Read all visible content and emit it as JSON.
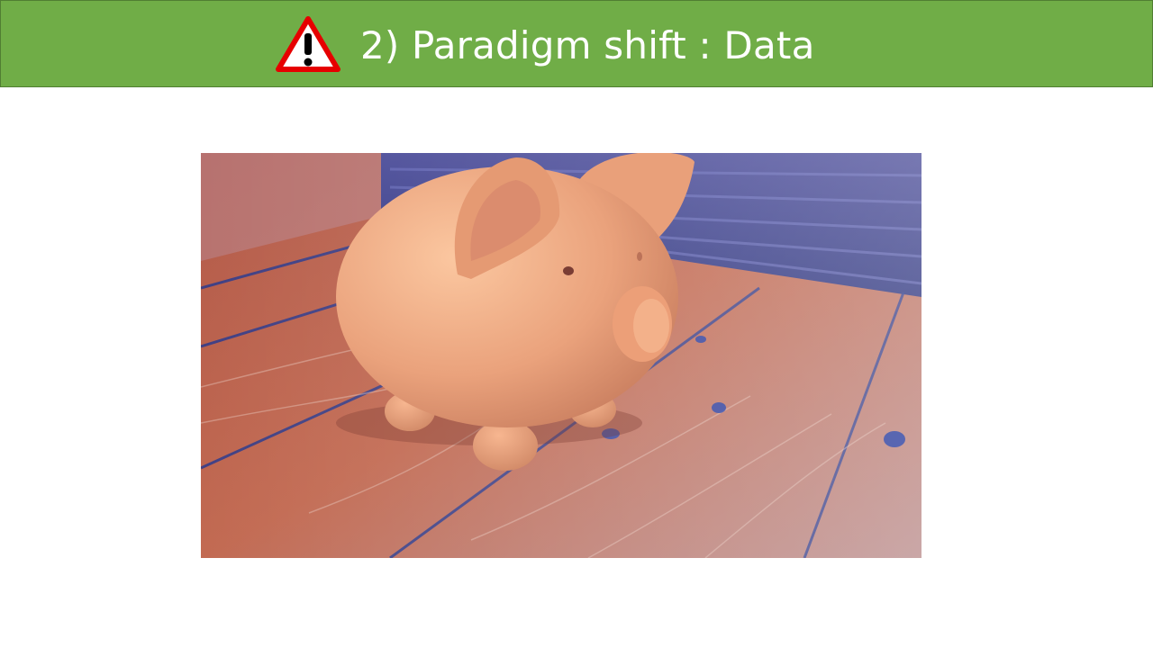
{
  "slide": {
    "title": "2) Paradigm shift : Data",
    "header_color": "#70ad47",
    "icon": "warning-icon",
    "image": {
      "subject": "piggy-bank-photo"
    }
  }
}
